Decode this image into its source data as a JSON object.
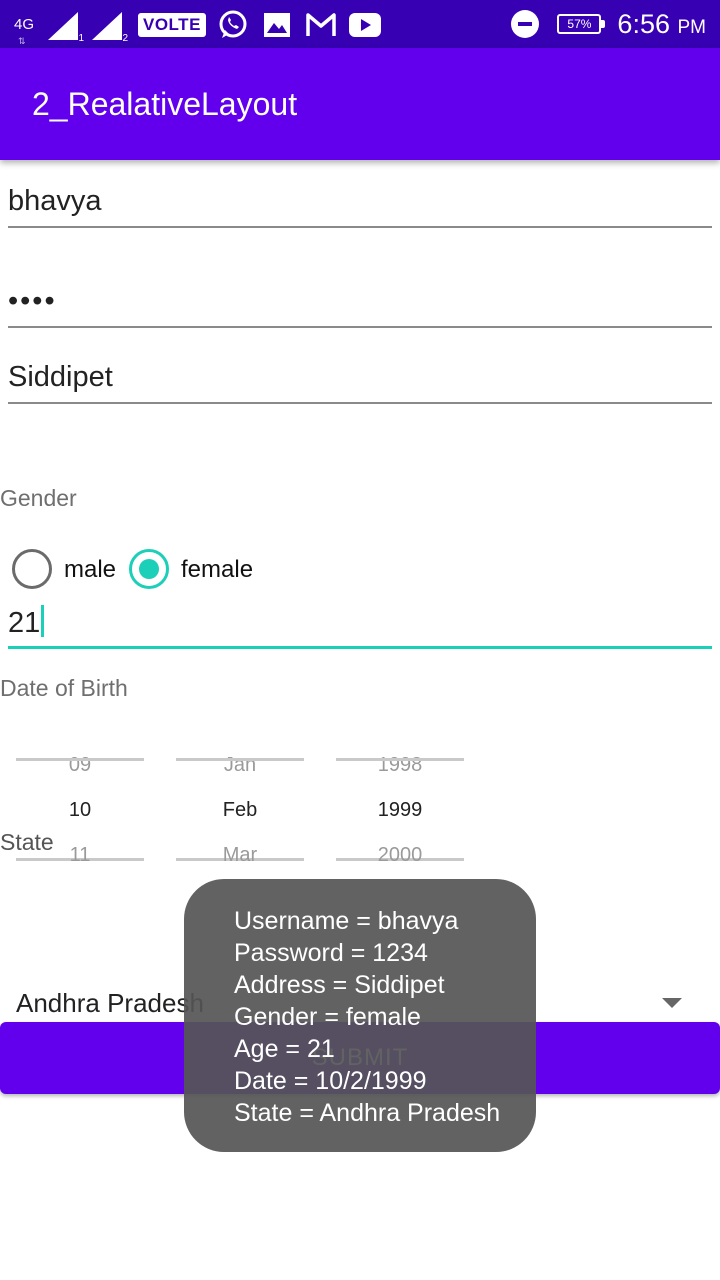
{
  "status_bar": {
    "network": "4G",
    "sim1_index": "1",
    "sim2_index": "2",
    "volte": "VOLTE",
    "battery": "57%",
    "time": "6:56",
    "ampm": "PM",
    "icons": [
      "whatsapp-icon",
      "gallery-icon",
      "gmail-icon",
      "youtube-icon",
      "dnd-icon"
    ]
  },
  "app_bar": {
    "title": "2_RealativeLayout"
  },
  "form": {
    "username": "bhavya",
    "password_masked": "••••",
    "address": "Siddipet",
    "gender_label": "Gender",
    "gender_options": [
      "male",
      "female"
    ],
    "gender_selected": "female",
    "age": "21",
    "dob_label": "Date of Birth",
    "date_picker": {
      "day": {
        "prev": "09",
        "current": "10",
        "next": "11"
      },
      "month": {
        "prev": "Jan",
        "current": "Feb",
        "next": "Mar"
      },
      "year": {
        "prev": "1998",
        "current": "1999",
        "next": "2000"
      }
    },
    "state_label": "State",
    "state_value": "Andhra Pradesh",
    "submit_label": "SUBMIT"
  },
  "toast": {
    "lines": [
      "Username = bhavya",
      "Password = 1234",
      "Address = Siddipet",
      "Gender = female",
      "Age = 21",
      "Date = 10/2/1999",
      "State = Andhra Pradesh"
    ]
  },
  "colors": {
    "status_bar": "#3700b3",
    "primary": "#6200ee",
    "accent": "#1ccfb8"
  }
}
